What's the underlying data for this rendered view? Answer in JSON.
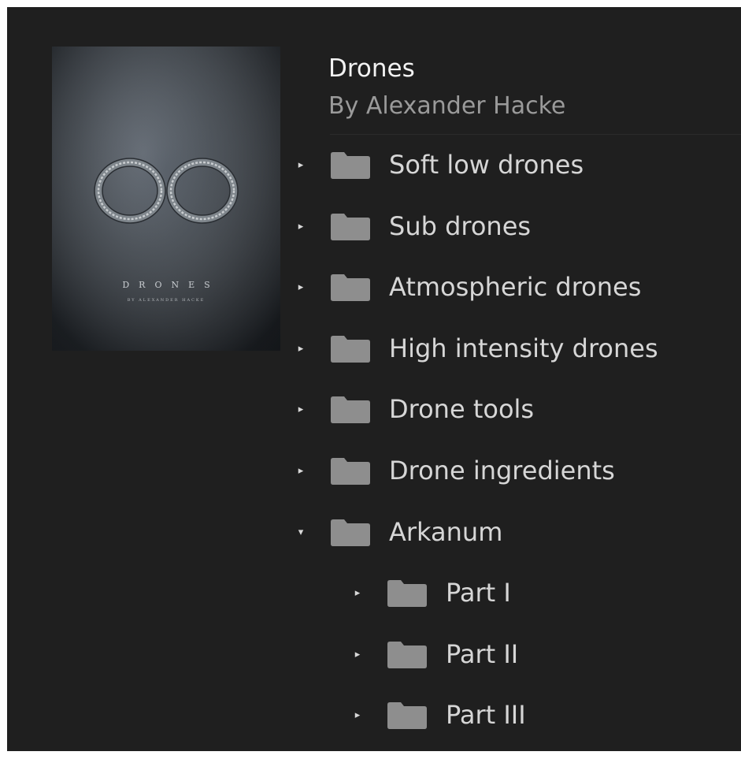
{
  "header": {
    "title": "Drones",
    "author": "By Alexander Hacke"
  },
  "cover": {
    "title": "DRONES",
    "subtitle": "BY ALEXANDER HACKE"
  },
  "tree": [
    {
      "label": "Soft low drones",
      "level": 0,
      "expanded": false
    },
    {
      "label": "Sub drones",
      "level": 0,
      "expanded": false
    },
    {
      "label": "Atmospheric drones",
      "level": 0,
      "expanded": false
    },
    {
      "label": "High intensity drones",
      "level": 0,
      "expanded": false
    },
    {
      "label": "Drone tools",
      "level": 0,
      "expanded": false
    },
    {
      "label": "Drone ingredients",
      "level": 0,
      "expanded": false
    },
    {
      "label": "Arkanum",
      "level": 0,
      "expanded": true
    },
    {
      "label": "Part I",
      "level": 1,
      "expanded": false
    },
    {
      "label": "Part II",
      "level": 1,
      "expanded": false
    },
    {
      "label": "Part III",
      "level": 1,
      "expanded": false
    }
  ],
  "icons": {
    "collapsed": "triangle-right-icon",
    "expanded": "triangle-down-icon",
    "folder": "folder-icon"
  },
  "colors": {
    "background": "#1f1f1f",
    "folder": "#8e8e8e",
    "text": "#d6d6d6",
    "muted": "#9a9a9a"
  }
}
